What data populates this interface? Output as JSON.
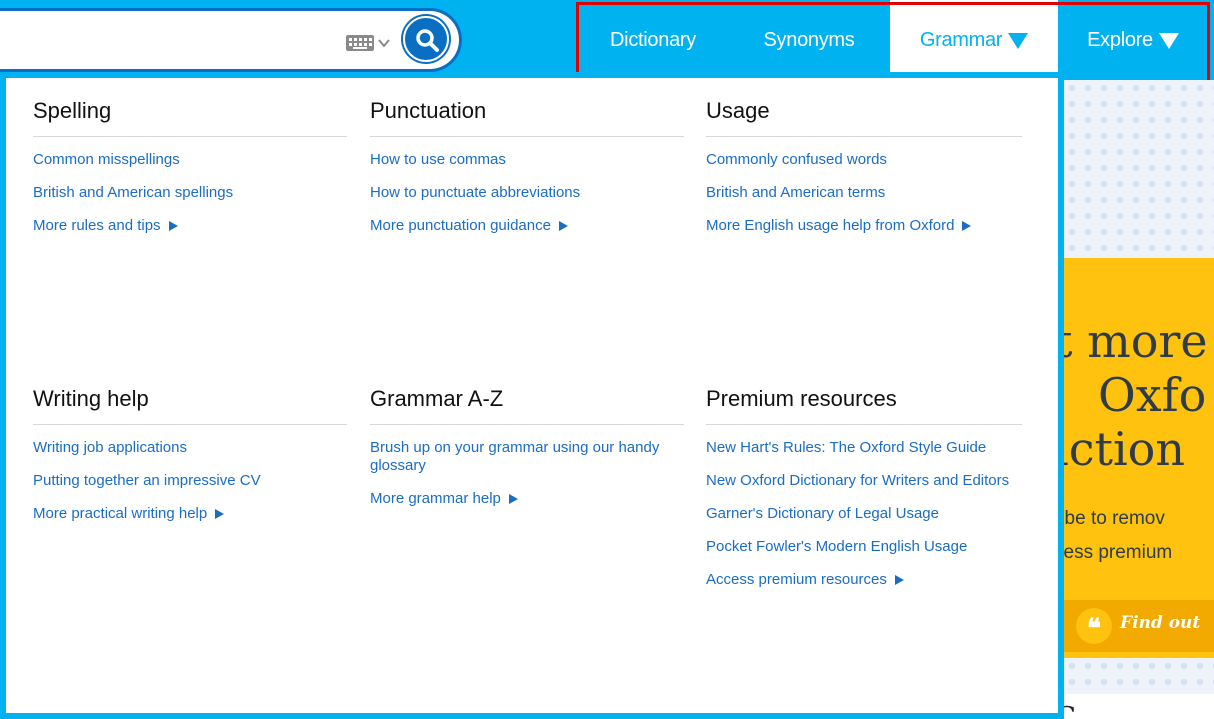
{
  "search": {
    "keyboard_icon": "keyboard-icon",
    "search_icon": "magnifier-icon"
  },
  "nav": {
    "items": [
      {
        "label": "Dictionary"
      },
      {
        "label": "Synonyms"
      },
      {
        "label": "Grammar"
      },
      {
        "label": "Explore"
      }
    ],
    "active": "Grammar",
    "highlight_color": "#e00000"
  },
  "colors": {
    "brand": "#00b2f0",
    "link": "#1a6dc4",
    "dark_blue": "#0a6fc2",
    "promo_yellow": "#ffc20e"
  },
  "menu": {
    "spelling": {
      "heading": "Spelling",
      "links": [
        "Common misspellings",
        "British and American spellings"
      ],
      "more": "More rules and tips"
    },
    "punctuation": {
      "heading": "Punctuation",
      "links": [
        "How to use commas",
        "How to punctuate abbreviations"
      ],
      "more": "More punctuation guidance"
    },
    "usage": {
      "heading": "Usage",
      "links": [
        "Commonly confused words",
        "British and American terms"
      ],
      "more": "More English usage help from Oxford"
    },
    "writing": {
      "heading": "Writing help",
      "links": [
        "Writing job applications",
        "Putting together an impressive CV"
      ],
      "more": "More practical writing help"
    },
    "grammar": {
      "heading": "Grammar A-Z",
      "links": [
        "Brush up on your grammar using our handy glossary"
      ],
      "more": "More grammar help"
    },
    "premium": {
      "heading": "Premium resources",
      "links": [
        "New Hart's Rules: The Oxford Style Guide",
        "New Oxford Dictionary for Writers and Editors",
        "Garner's Dictionary of Legal Usage",
        "Pocket Fowler's Modern English Usage"
      ],
      "more": "Access premium resources"
    }
  },
  "promo": {
    "line1": "t more",
    "line2": "Oxfo",
    "line3": "iction",
    "line4": "ribe to remov",
    "line5": "cess premium",
    "cta": "Find out",
    "quote_glyph": "❝",
    "bottom": "C"
  }
}
